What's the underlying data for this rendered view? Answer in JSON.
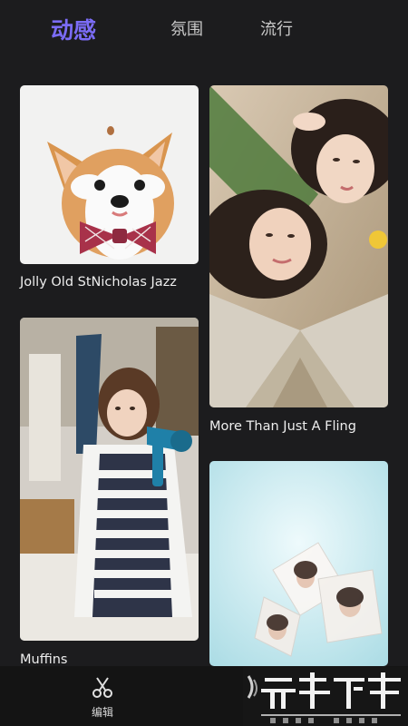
{
  "tabs": [
    {
      "label": "动感",
      "active": true
    },
    {
      "label": "氛围",
      "active": false
    },
    {
      "label": "流行",
      "active": false
    }
  ],
  "cards": [
    {
      "title": "Jolly Old StNicholas Jazz",
      "image": "corgi-with-bow-tie"
    },
    {
      "title": "More Than Just A Fling",
      "image": "two-women-lying-down"
    },
    {
      "title": "Muffins",
      "image": "woman-with-hair-dryer"
    },
    {
      "title": "",
      "image": "photo-cube-collage"
    }
  ],
  "bottom_nav": {
    "edit_label": "编辑",
    "edit_icon": "scissors-icon"
  },
  "watermark": {
    "text": "元皮下载",
    "url": "www.yuanpi.com"
  },
  "colors": {
    "background": "#1c1c1e",
    "accent": "#7b6cf6",
    "bottom_bar": "#141414"
  }
}
